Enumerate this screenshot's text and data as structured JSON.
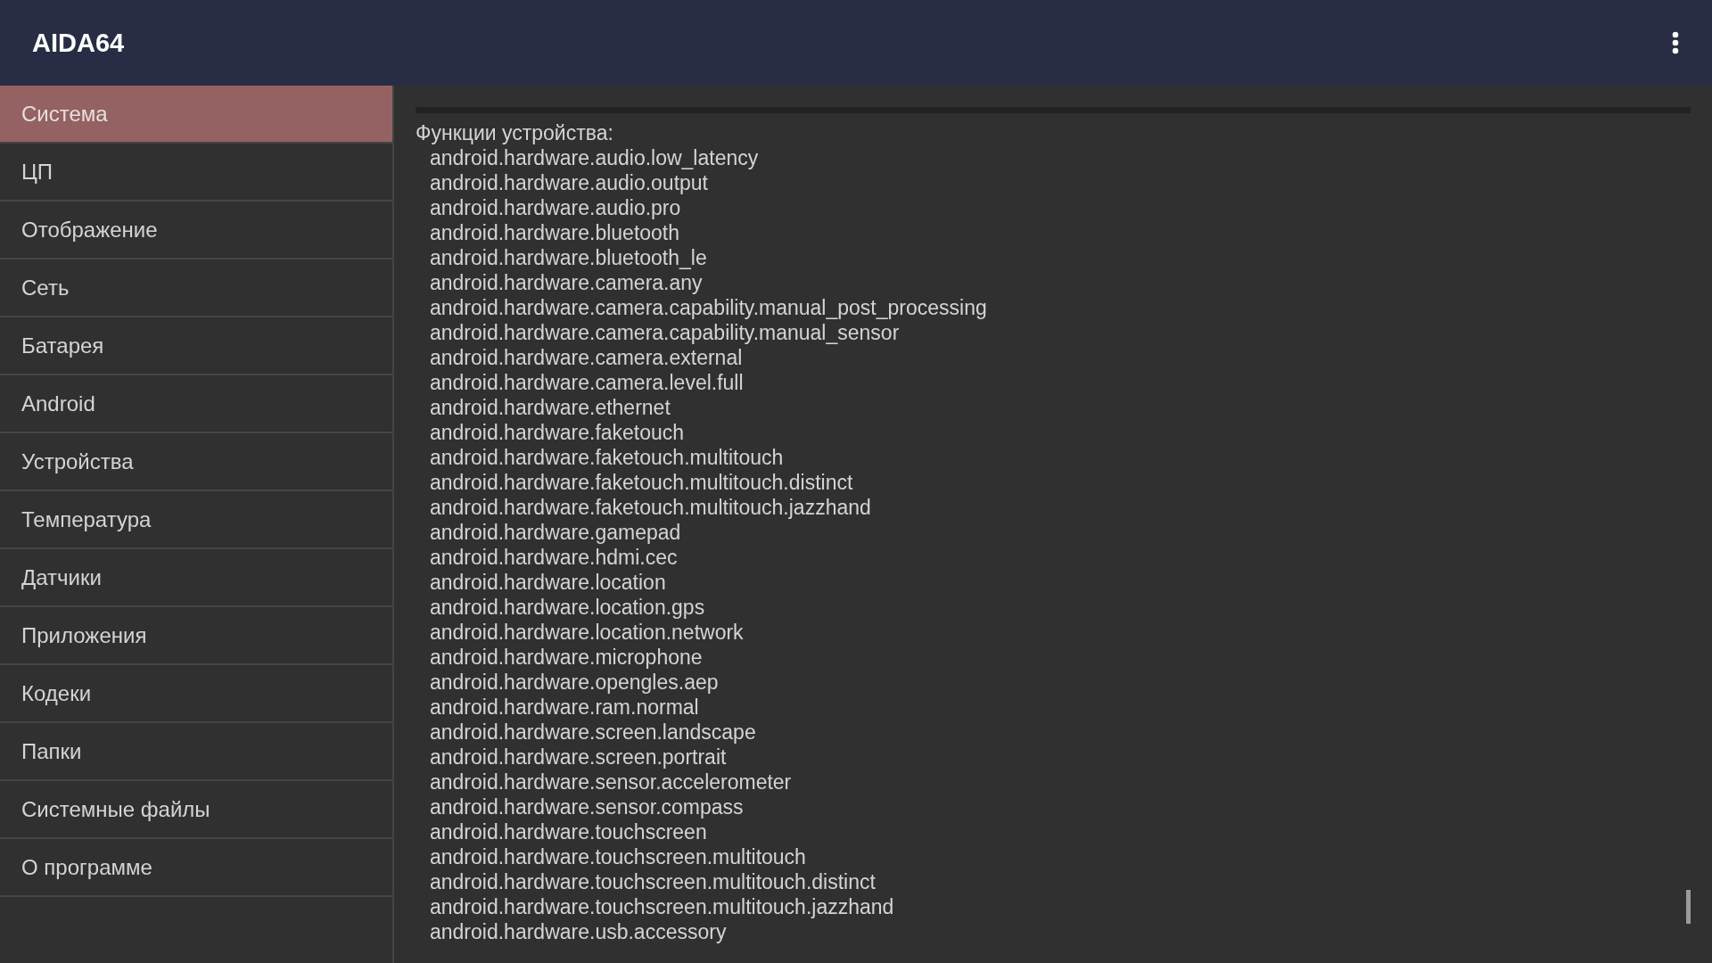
{
  "app_bar": {
    "title": "AIDA64"
  },
  "sidebar": {
    "items": [
      {
        "label": "Система",
        "selected": true
      },
      {
        "label": "ЦП",
        "selected": false
      },
      {
        "label": "Отображение",
        "selected": false
      },
      {
        "label": "Сеть",
        "selected": false
      },
      {
        "label": "Батарея",
        "selected": false
      },
      {
        "label": "Android",
        "selected": false
      },
      {
        "label": "Устройства",
        "selected": false
      },
      {
        "label": "Температура",
        "selected": false
      },
      {
        "label": "Датчики",
        "selected": false
      },
      {
        "label": "Приложения",
        "selected": false
      },
      {
        "label": "Кодеки",
        "selected": false
      },
      {
        "label": "Папки",
        "selected": false
      },
      {
        "label": "Системные файлы",
        "selected": false
      },
      {
        "label": "О программе",
        "selected": false
      }
    ]
  },
  "content": {
    "heading": "Функции устройства:",
    "features": [
      "android.hardware.audio.low_latency",
      "android.hardware.audio.output",
      "android.hardware.audio.pro",
      "android.hardware.bluetooth",
      "android.hardware.bluetooth_le",
      "android.hardware.camera.any",
      "android.hardware.camera.capability.manual_post_processing",
      "android.hardware.camera.capability.manual_sensor",
      "android.hardware.camera.external",
      "android.hardware.camera.level.full",
      "android.hardware.ethernet",
      "android.hardware.faketouch",
      "android.hardware.faketouch.multitouch",
      "android.hardware.faketouch.multitouch.distinct",
      "android.hardware.faketouch.multitouch.jazzhand",
      "android.hardware.gamepad",
      "android.hardware.hdmi.cec",
      "android.hardware.location",
      "android.hardware.location.gps",
      "android.hardware.location.network",
      "android.hardware.microphone",
      "android.hardware.opengles.aep",
      "android.hardware.ram.normal",
      "android.hardware.screen.landscape",
      "android.hardware.screen.portrait",
      "android.hardware.sensor.accelerometer",
      "android.hardware.sensor.compass",
      "android.hardware.touchscreen",
      "android.hardware.touchscreen.multitouch",
      "android.hardware.touchscreen.multitouch.distinct",
      "android.hardware.touchscreen.multitouch.jazzhand",
      "android.hardware.usb.accessory"
    ]
  }
}
